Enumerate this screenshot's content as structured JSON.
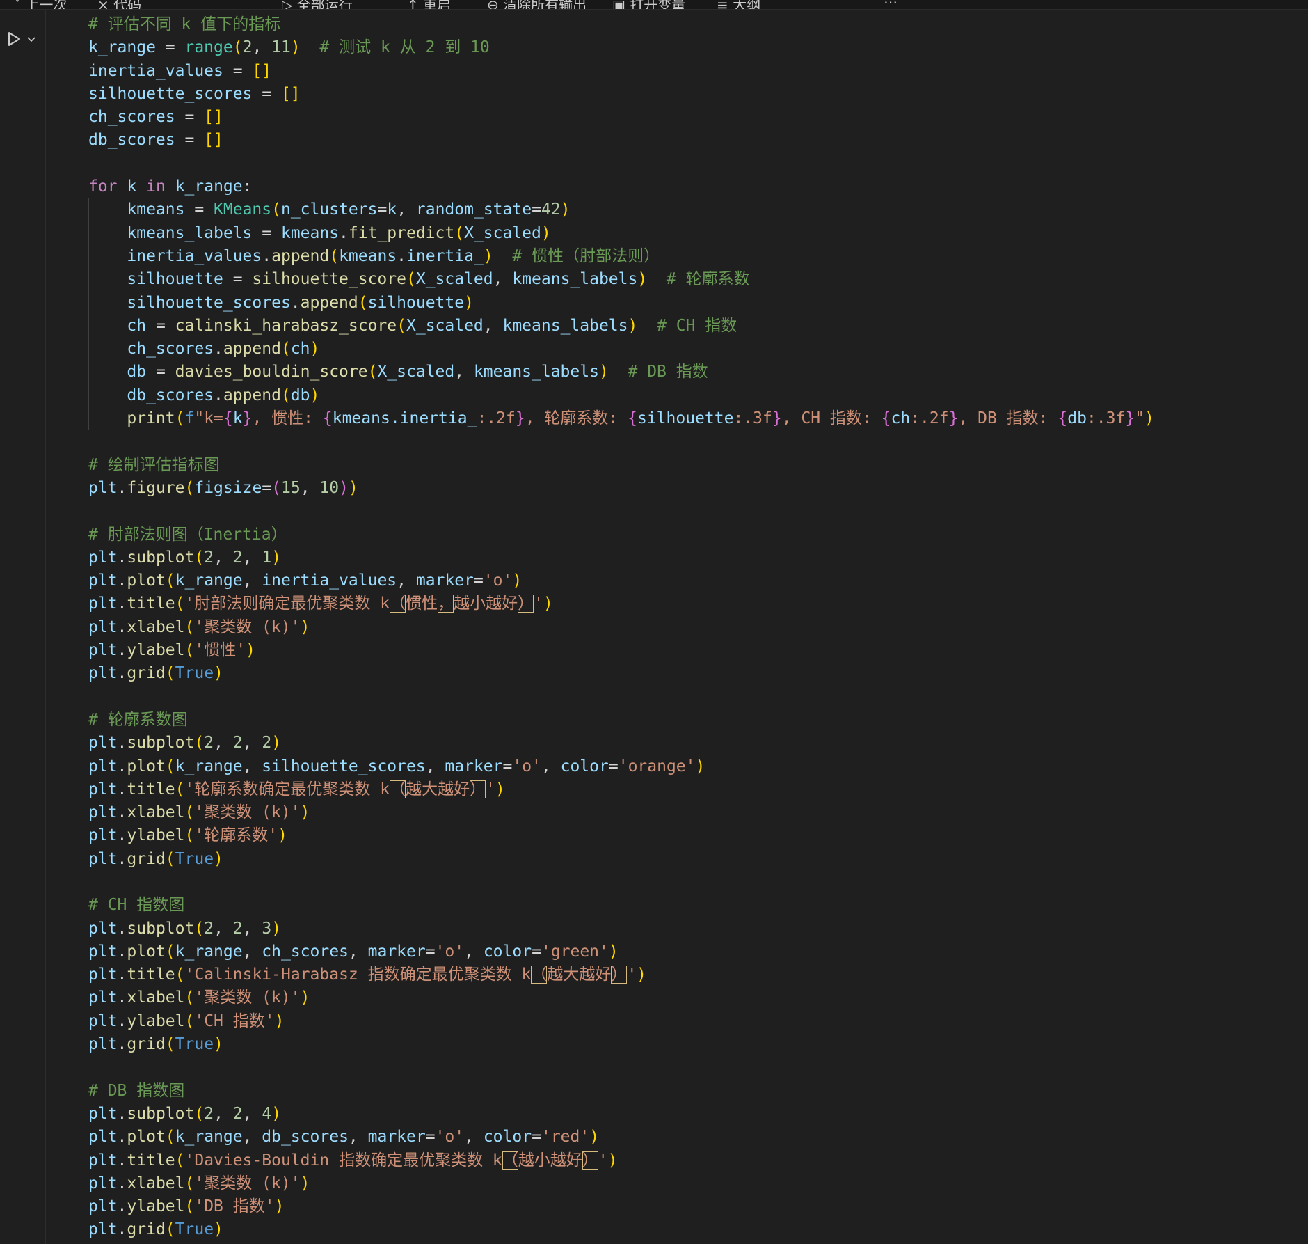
{
  "toolbar_fragments": [
    "˅ 上一次",
    "× 代码",
    "▷ 全部运行",
    "↑ 重启",
    "⊖ 清除所有输出",
    "▣ 打开变量",
    "≡ 大纲",
    "⋯"
  ],
  "code_lines": [
    [
      [
        "com",
        "# 评估不同 k 值下的指标"
      ]
    ],
    [
      [
        "var",
        "k_range"
      ],
      [
        "op",
        " = "
      ],
      [
        "cls",
        "range"
      ],
      [
        "p1",
        "("
      ],
      [
        "num",
        "2"
      ],
      [
        "op",
        ", "
      ],
      [
        "num",
        "11"
      ],
      [
        "p1",
        ")"
      ],
      [
        "op",
        "  "
      ],
      [
        "com",
        "# 测试 k 从 2 到 10"
      ]
    ],
    [
      [
        "var",
        "inertia_values"
      ],
      [
        "op",
        " = "
      ],
      [
        "p1",
        "[]"
      ]
    ],
    [
      [
        "var",
        "silhouette_scores"
      ],
      [
        "op",
        " = "
      ],
      [
        "p1",
        "[]"
      ]
    ],
    [
      [
        "var",
        "ch_scores"
      ],
      [
        "op",
        " = "
      ],
      [
        "p1",
        "[]"
      ]
    ],
    [
      [
        "var",
        "db_scores"
      ],
      [
        "op",
        " = "
      ],
      [
        "p1",
        "[]"
      ]
    ],
    [],
    [
      [
        "kw",
        "for"
      ],
      [
        "op",
        " "
      ],
      [
        "var",
        "k"
      ],
      [
        "op",
        " "
      ],
      [
        "kw",
        "in"
      ],
      [
        "op",
        " "
      ],
      [
        "var",
        "k_range"
      ],
      [
        "op",
        ":"
      ]
    ],
    [
      [
        "op",
        "    "
      ],
      [
        "var",
        "kmeans"
      ],
      [
        "op",
        " = "
      ],
      [
        "cls",
        "KMeans"
      ],
      [
        "p1",
        "("
      ],
      [
        "var",
        "n_clusters"
      ],
      [
        "op",
        "="
      ],
      [
        "var",
        "k"
      ],
      [
        "op",
        ", "
      ],
      [
        "var",
        "random_state"
      ],
      [
        "op",
        "="
      ],
      [
        "num",
        "42"
      ],
      [
        "p1",
        ")"
      ]
    ],
    [
      [
        "op",
        "    "
      ],
      [
        "var",
        "kmeans_labels"
      ],
      [
        "op",
        " = "
      ],
      [
        "var",
        "kmeans"
      ],
      [
        "op",
        "."
      ],
      [
        "fn",
        "fit_predict"
      ],
      [
        "p1",
        "("
      ],
      [
        "var",
        "X_scaled"
      ],
      [
        "p1",
        ")"
      ]
    ],
    [
      [
        "op",
        "    "
      ],
      [
        "var",
        "inertia_values"
      ],
      [
        "op",
        "."
      ],
      [
        "fn",
        "append"
      ],
      [
        "p1",
        "("
      ],
      [
        "var",
        "kmeans"
      ],
      [
        "op",
        "."
      ],
      [
        "var",
        "inertia_"
      ],
      [
        "p1",
        ")"
      ],
      [
        "op",
        "  "
      ],
      [
        "com",
        "# 惯性（肘部法则）"
      ]
    ],
    [
      [
        "op",
        "    "
      ],
      [
        "var",
        "silhouette"
      ],
      [
        "op",
        " = "
      ],
      [
        "fn",
        "silhouette_score"
      ],
      [
        "p1",
        "("
      ],
      [
        "var",
        "X_scaled"
      ],
      [
        "op",
        ", "
      ],
      [
        "var",
        "kmeans_labels"
      ],
      [
        "p1",
        ")"
      ],
      [
        "op",
        "  "
      ],
      [
        "com",
        "# 轮廓系数"
      ]
    ],
    [
      [
        "op",
        "    "
      ],
      [
        "var",
        "silhouette_scores"
      ],
      [
        "op",
        "."
      ],
      [
        "fn",
        "append"
      ],
      [
        "p1",
        "("
      ],
      [
        "var",
        "silhouette"
      ],
      [
        "p1",
        ")"
      ]
    ],
    [
      [
        "op",
        "    "
      ],
      [
        "var",
        "ch"
      ],
      [
        "op",
        " = "
      ],
      [
        "fn",
        "calinski_harabasz_score"
      ],
      [
        "p1",
        "("
      ],
      [
        "var",
        "X_scaled"
      ],
      [
        "op",
        ", "
      ],
      [
        "var",
        "kmeans_labels"
      ],
      [
        "p1",
        ")"
      ],
      [
        "op",
        "  "
      ],
      [
        "com",
        "# CH 指数"
      ]
    ],
    [
      [
        "op",
        "    "
      ],
      [
        "var",
        "ch_scores"
      ],
      [
        "op",
        "."
      ],
      [
        "fn",
        "append"
      ],
      [
        "p1",
        "("
      ],
      [
        "var",
        "ch"
      ],
      [
        "p1",
        ")"
      ]
    ],
    [
      [
        "op",
        "    "
      ],
      [
        "var",
        "db"
      ],
      [
        "op",
        " = "
      ],
      [
        "fn",
        "davies_bouldin_score"
      ],
      [
        "p1",
        "("
      ],
      [
        "var",
        "X_scaled"
      ],
      [
        "op",
        ", "
      ],
      [
        "var",
        "kmeans_labels"
      ],
      [
        "p1",
        ")"
      ],
      [
        "op",
        "  "
      ],
      [
        "com",
        "# DB 指数"
      ]
    ],
    [
      [
        "op",
        "    "
      ],
      [
        "var",
        "db_scores"
      ],
      [
        "op",
        "."
      ],
      [
        "fn",
        "append"
      ],
      [
        "p1",
        "("
      ],
      [
        "var",
        "db"
      ],
      [
        "p1",
        ")"
      ]
    ],
    [
      [
        "op",
        "    "
      ],
      [
        "fn",
        "print"
      ],
      [
        "p1",
        "("
      ],
      [
        "fstr",
        "f"
      ],
      [
        "str",
        "\"k="
      ],
      [
        "p2",
        "{"
      ],
      [
        "var",
        "k"
      ],
      [
        "p2",
        "}"
      ],
      [
        "str",
        ", 惯性: "
      ],
      [
        "p2",
        "{"
      ],
      [
        "var",
        "kmeans.inertia_"
      ],
      [
        "str",
        ":.2f"
      ],
      [
        "p2",
        "}"
      ],
      [
        "str",
        ", 轮廓系数: "
      ],
      [
        "p2",
        "{"
      ],
      [
        "var",
        "silhouette"
      ],
      [
        "str",
        ":.3f"
      ],
      [
        "p2",
        "}"
      ],
      [
        "str",
        ", CH 指数: "
      ],
      [
        "p2",
        "{"
      ],
      [
        "var",
        "ch"
      ],
      [
        "str",
        ":.2f"
      ],
      [
        "p2",
        "}"
      ],
      [
        "str",
        ", DB 指数: "
      ],
      [
        "p2",
        "{"
      ],
      [
        "var",
        "db"
      ],
      [
        "str",
        ":.3f"
      ],
      [
        "p2",
        "}"
      ],
      [
        "str",
        "\""
      ],
      [
        "p1",
        ")"
      ]
    ],
    [],
    [
      [
        "com",
        "# 绘制评估指标图"
      ]
    ],
    [
      [
        "var",
        "plt"
      ],
      [
        "op",
        "."
      ],
      [
        "fn",
        "figure"
      ],
      [
        "p1",
        "("
      ],
      [
        "var",
        "figsize"
      ],
      [
        "op",
        "="
      ],
      [
        "p2",
        "("
      ],
      [
        "num",
        "15"
      ],
      [
        "op",
        ", "
      ],
      [
        "num",
        "10"
      ],
      [
        "p2",
        ")"
      ],
      [
        "p1",
        ")"
      ]
    ],
    [],
    [
      [
        "com",
        "# 肘部法则图（Inertia）"
      ]
    ],
    [
      [
        "var",
        "plt"
      ],
      [
        "op",
        "."
      ],
      [
        "fn",
        "subplot"
      ],
      [
        "p1",
        "("
      ],
      [
        "num",
        "2"
      ],
      [
        "op",
        ", "
      ],
      [
        "num",
        "2"
      ],
      [
        "op",
        ", "
      ],
      [
        "num",
        "1"
      ],
      [
        "p1",
        ")"
      ]
    ],
    [
      [
        "var",
        "plt"
      ],
      [
        "op",
        "."
      ],
      [
        "fn",
        "plot"
      ],
      [
        "p1",
        "("
      ],
      [
        "var",
        "k_range"
      ],
      [
        "op",
        ", "
      ],
      [
        "var",
        "inertia_values"
      ],
      [
        "op",
        ", "
      ],
      [
        "var",
        "marker"
      ],
      [
        "op",
        "="
      ],
      [
        "str",
        "'o'"
      ],
      [
        "p1",
        ")"
      ]
    ],
    [
      [
        "var",
        "plt"
      ],
      [
        "op",
        "."
      ],
      [
        "fn",
        "title"
      ],
      [
        "p1",
        "("
      ],
      [
        "str",
        "'肘部法则确定最优聚类数 k"
      ],
      [
        "strbox",
        "（"
      ],
      [
        "str",
        "惯性"
      ],
      [
        "strbox",
        "，"
      ],
      [
        "str",
        "越小越好"
      ],
      [
        "strbox",
        "）"
      ],
      [
        "str",
        "'"
      ],
      [
        "p1",
        ")"
      ]
    ],
    [
      [
        "var",
        "plt"
      ],
      [
        "op",
        "."
      ],
      [
        "fn",
        "xlabel"
      ],
      [
        "p1",
        "("
      ],
      [
        "str",
        "'聚类数 (k)'"
      ],
      [
        "p1",
        ")"
      ]
    ],
    [
      [
        "var",
        "plt"
      ],
      [
        "op",
        "."
      ],
      [
        "fn",
        "ylabel"
      ],
      [
        "p1",
        "("
      ],
      [
        "str",
        "'惯性'"
      ],
      [
        "p1",
        ")"
      ]
    ],
    [
      [
        "var",
        "plt"
      ],
      [
        "op",
        "."
      ],
      [
        "fn",
        "grid"
      ],
      [
        "p1",
        "("
      ],
      [
        "const",
        "True"
      ],
      [
        "p1",
        ")"
      ]
    ],
    [],
    [
      [
        "com",
        "# 轮廓系数图"
      ]
    ],
    [
      [
        "var",
        "plt"
      ],
      [
        "op",
        "."
      ],
      [
        "fn",
        "subplot"
      ],
      [
        "p1",
        "("
      ],
      [
        "num",
        "2"
      ],
      [
        "op",
        ", "
      ],
      [
        "num",
        "2"
      ],
      [
        "op",
        ", "
      ],
      [
        "num",
        "2"
      ],
      [
        "p1",
        ")"
      ]
    ],
    [
      [
        "var",
        "plt"
      ],
      [
        "op",
        "."
      ],
      [
        "fn",
        "plot"
      ],
      [
        "p1",
        "("
      ],
      [
        "var",
        "k_range"
      ],
      [
        "op",
        ", "
      ],
      [
        "var",
        "silhouette_scores"
      ],
      [
        "op",
        ", "
      ],
      [
        "var",
        "marker"
      ],
      [
        "op",
        "="
      ],
      [
        "str",
        "'o'"
      ],
      [
        "op",
        ", "
      ],
      [
        "var",
        "color"
      ],
      [
        "op",
        "="
      ],
      [
        "str",
        "'orange'"
      ],
      [
        "p1",
        ")"
      ]
    ],
    [
      [
        "var",
        "plt"
      ],
      [
        "op",
        "."
      ],
      [
        "fn",
        "title"
      ],
      [
        "p1",
        "("
      ],
      [
        "str",
        "'轮廓系数确定最优聚类数 k"
      ],
      [
        "strbox",
        "（"
      ],
      [
        "str",
        "越大越好"
      ],
      [
        "strbox",
        "）"
      ],
      [
        "str",
        "'"
      ],
      [
        "p1",
        ")"
      ]
    ],
    [
      [
        "var",
        "plt"
      ],
      [
        "op",
        "."
      ],
      [
        "fn",
        "xlabel"
      ],
      [
        "p1",
        "("
      ],
      [
        "str",
        "'聚类数 (k)'"
      ],
      [
        "p1",
        ")"
      ]
    ],
    [
      [
        "var",
        "plt"
      ],
      [
        "op",
        "."
      ],
      [
        "fn",
        "ylabel"
      ],
      [
        "p1",
        "("
      ],
      [
        "str",
        "'轮廓系数'"
      ],
      [
        "p1",
        ")"
      ]
    ],
    [
      [
        "var",
        "plt"
      ],
      [
        "op",
        "."
      ],
      [
        "fn",
        "grid"
      ],
      [
        "p1",
        "("
      ],
      [
        "const",
        "True"
      ],
      [
        "p1",
        ")"
      ]
    ],
    [],
    [
      [
        "com",
        "# CH 指数图"
      ]
    ],
    [
      [
        "var",
        "plt"
      ],
      [
        "op",
        "."
      ],
      [
        "fn",
        "subplot"
      ],
      [
        "p1",
        "("
      ],
      [
        "num",
        "2"
      ],
      [
        "op",
        ", "
      ],
      [
        "num",
        "2"
      ],
      [
        "op",
        ", "
      ],
      [
        "num",
        "3"
      ],
      [
        "p1",
        ")"
      ]
    ],
    [
      [
        "var",
        "plt"
      ],
      [
        "op",
        "."
      ],
      [
        "fn",
        "plot"
      ],
      [
        "p1",
        "("
      ],
      [
        "var",
        "k_range"
      ],
      [
        "op",
        ", "
      ],
      [
        "var",
        "ch_scores"
      ],
      [
        "op",
        ", "
      ],
      [
        "var",
        "marker"
      ],
      [
        "op",
        "="
      ],
      [
        "str",
        "'o'"
      ],
      [
        "op",
        ", "
      ],
      [
        "var",
        "color"
      ],
      [
        "op",
        "="
      ],
      [
        "str",
        "'green'"
      ],
      [
        "p1",
        ")"
      ]
    ],
    [
      [
        "var",
        "plt"
      ],
      [
        "op",
        "."
      ],
      [
        "fn",
        "title"
      ],
      [
        "p1",
        "("
      ],
      [
        "str",
        "'Calinski-Harabasz 指数确定最优聚类数 k"
      ],
      [
        "strbox",
        "（"
      ],
      [
        "str",
        "越大越好"
      ],
      [
        "strbox",
        "）"
      ],
      [
        "str",
        "'"
      ],
      [
        "p1",
        ")"
      ]
    ],
    [
      [
        "var",
        "plt"
      ],
      [
        "op",
        "."
      ],
      [
        "fn",
        "xlabel"
      ],
      [
        "p1",
        "("
      ],
      [
        "str",
        "'聚类数 (k)'"
      ],
      [
        "p1",
        ")"
      ]
    ],
    [
      [
        "var",
        "plt"
      ],
      [
        "op",
        "."
      ],
      [
        "fn",
        "ylabel"
      ],
      [
        "p1",
        "("
      ],
      [
        "str",
        "'CH 指数'"
      ],
      [
        "p1",
        ")"
      ]
    ],
    [
      [
        "var",
        "plt"
      ],
      [
        "op",
        "."
      ],
      [
        "fn",
        "grid"
      ],
      [
        "p1",
        "("
      ],
      [
        "const",
        "True"
      ],
      [
        "p1",
        ")"
      ]
    ],
    [],
    [
      [
        "com",
        "# DB 指数图"
      ]
    ],
    [
      [
        "var",
        "plt"
      ],
      [
        "op",
        "."
      ],
      [
        "fn",
        "subplot"
      ],
      [
        "p1",
        "("
      ],
      [
        "num",
        "2"
      ],
      [
        "op",
        ", "
      ],
      [
        "num",
        "2"
      ],
      [
        "op",
        ", "
      ],
      [
        "num",
        "4"
      ],
      [
        "p1",
        ")"
      ]
    ],
    [
      [
        "var",
        "plt"
      ],
      [
        "op",
        "."
      ],
      [
        "fn",
        "plot"
      ],
      [
        "p1",
        "("
      ],
      [
        "var",
        "k_range"
      ],
      [
        "op",
        ", "
      ],
      [
        "var",
        "db_scores"
      ],
      [
        "op",
        ", "
      ],
      [
        "var",
        "marker"
      ],
      [
        "op",
        "="
      ],
      [
        "str",
        "'o'"
      ],
      [
        "op",
        ", "
      ],
      [
        "var",
        "color"
      ],
      [
        "op",
        "="
      ],
      [
        "str",
        "'red'"
      ],
      [
        "p1",
        ")"
      ]
    ],
    [
      [
        "var",
        "plt"
      ],
      [
        "op",
        "."
      ],
      [
        "fn",
        "title"
      ],
      [
        "p1",
        "("
      ],
      [
        "str",
        "'Davies-Bouldin 指数确定最优聚类数 k"
      ],
      [
        "strbox",
        "（"
      ],
      [
        "str",
        "越小越好"
      ],
      [
        "strbox",
        "）"
      ],
      [
        "str",
        "'"
      ],
      [
        "p1",
        ")"
      ]
    ],
    [
      [
        "var",
        "plt"
      ],
      [
        "op",
        "."
      ],
      [
        "fn",
        "xlabel"
      ],
      [
        "p1",
        "("
      ],
      [
        "str",
        "'聚类数 (k)'"
      ],
      [
        "p1",
        ")"
      ]
    ],
    [
      [
        "var",
        "plt"
      ],
      [
        "op",
        "."
      ],
      [
        "fn",
        "ylabel"
      ],
      [
        "p1",
        "("
      ],
      [
        "str",
        "'DB 指数'"
      ],
      [
        "p1",
        ")"
      ]
    ],
    [
      [
        "var",
        "plt"
      ],
      [
        "op",
        "."
      ],
      [
        "fn",
        "grid"
      ],
      [
        "p1",
        "("
      ],
      [
        "const",
        "True"
      ],
      [
        "p1",
        ")"
      ]
    ]
  ]
}
